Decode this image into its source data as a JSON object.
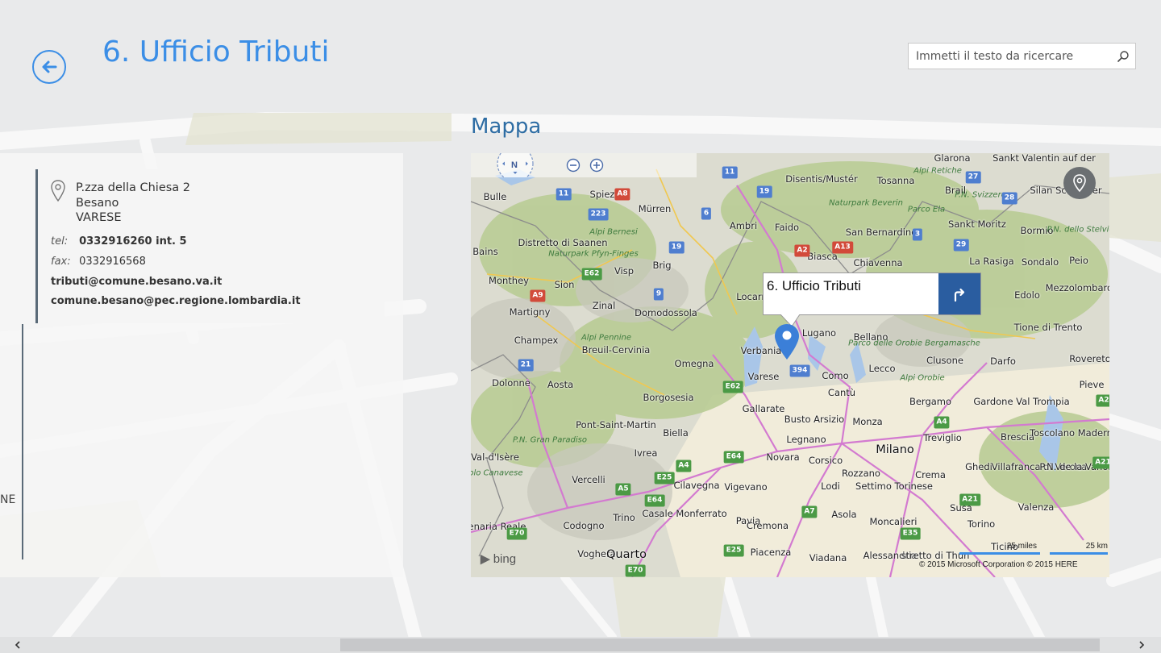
{
  "header": {
    "title": "6. Ufficio Tributi",
    "search_placeholder": "Immetti il testo da ricercare"
  },
  "contact": {
    "address_lines": [
      "P.zza della Chiesa 2",
      "Besano",
      "VARESE"
    ],
    "tel_label": "tel:",
    "tel_value": "0332916260 int. 5",
    "fax_label": "fax:",
    "fax_value": "0332916568",
    "email": "tributi@comune.besano.va.it",
    "pec": "comune.besano@pec.regione.lombardia.it",
    "cut_text": "NE"
  },
  "map": {
    "heading": "Mappa",
    "compass_label": "N",
    "callout_title": "6. Ufficio Tributi",
    "bing_label": "bing",
    "scale_miles": "25 miles",
    "scale_km": "25 km",
    "copyright": "© 2015 Microsoft Corporation    © 2015 HERE",
    "places": [
      "Glarona",
      "Sankt Valentin auf der",
      "Disentis/Mustér",
      "Tosanna",
      "Alpi Retiche",
      "Brail",
      "P.N. Svizzero",
      "Silan Schlander",
      "Bulle",
      "Spiez",
      "Mürren",
      "Naturpark Beverin",
      "Parco Ela",
      "Distretto di Saanen",
      "Alpi Bernesi",
      "Ambri",
      "Faido",
      "San Bernardino",
      "Sankt Moritz",
      "Bormio",
      "P.N. dello Stelvio",
      "Bains",
      "Naturpark Pfyn-Finges",
      "Brig",
      "Biasca",
      "Chiavenna",
      "La Rasiga",
      "Sondalo",
      "Peio",
      "Monthey",
      "Sion",
      "Visp",
      "Locarno",
      "Edolo",
      "Mezzolombardo",
      "Martigny",
      "Zinal",
      "Domodossola",
      "Lugano",
      "Champex",
      "Alpi Pennine",
      "Breuil-Cervinia",
      "Verbania",
      "Bellano",
      "Parco delle Orobie Bergamasche",
      "Tione di Trento",
      "Omegna",
      "Clusone",
      "Darfo",
      "Rovereto",
      "Dolonne",
      "Aosta",
      "Varese",
      "Como",
      "Lecco",
      "Alpi Orobie",
      "Pieve",
      "Borgosesia",
      "Cantù",
      "Bergamo",
      "Gardone Val Trompia",
      "Gallarate",
      "Busto Arsizio",
      "Monza",
      "Pont-Saint-Martin",
      "P.N. Gran Paradiso",
      "Biella",
      "Legnano",
      "Milano",
      "Treviglio",
      "Brescia",
      "Toscolano Maderno",
      "Val-d'Isère",
      "Ivrea",
      "Novara",
      "Corsico",
      "Rozzano",
      "Crema",
      "Ghedi",
      "Villafranca di Verona",
      "P.N. de la Vanoise",
      "Rivarolo Canavese",
      "Vercelli",
      "Cilavegna",
      "Vigevano",
      "Lodi",
      "Settimo Torinese",
      "Trino",
      "Casale Monferrato",
      "Pavia",
      "Asola",
      "Susa",
      "Venaria Reale",
      "Codogno",
      "Cremona",
      "Moncalieri",
      "Torino",
      "Valenza",
      "Voghera",
      "Quarto",
      "Piacenza",
      "Viadana",
      "Alessandria",
      "stretto di Thun",
      "Ticino"
    ],
    "shields": [
      "11",
      "A8",
      "11",
      "19",
      "6",
      "27",
      "28",
      "223",
      "19",
      "3",
      "29",
      "E62",
      "A13",
      "A2",
      "9",
      "A9",
      "21",
      "394",
      "E62",
      "A4",
      "A4",
      "E64",
      "A5",
      "E25",
      "E64",
      "A7",
      "A21",
      "E70",
      "E35",
      "A21",
      "A2",
      "E25",
      "E70"
    ]
  },
  "colors": {
    "accent": "#3b8ee6",
    "map_heading": "#2e6da4",
    "callout_button": "#2a5da0",
    "panel_border": "#5a6a78"
  }
}
